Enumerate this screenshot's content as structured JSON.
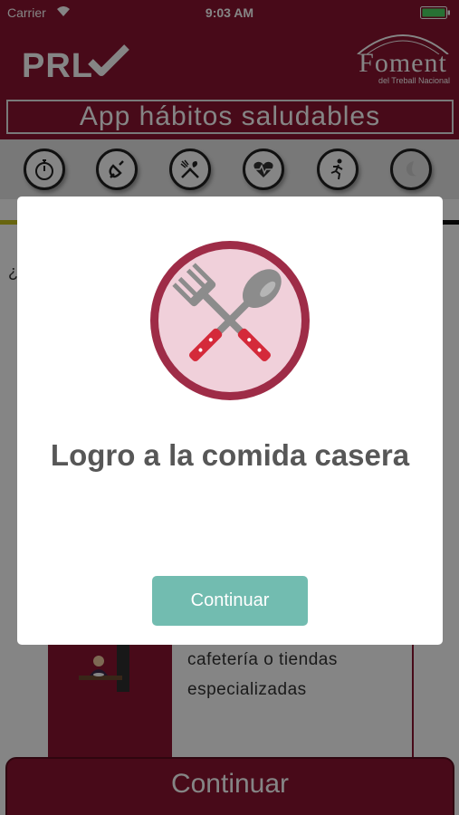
{
  "status_bar": {
    "carrier": "Carrier",
    "time": "9:03 AM"
  },
  "header": {
    "logo_text": "PRL",
    "org_name": "Foment",
    "org_sub": "del Treball Nacional",
    "app_title": "App hábitos saludables"
  },
  "categories": [
    {
      "icon": "stopwatch-icon"
    },
    {
      "icon": "phone-icon"
    },
    {
      "icon": "fork-spoon-icon"
    },
    {
      "icon": "heart-pulse-icon"
    },
    {
      "icon": "runner-icon"
    },
    {
      "icon": "moon-icon"
    }
  ],
  "page": {
    "question_fragment": "¿",
    "card_text": "cafetería o tiendas especializadas",
    "continue_label": "Continuar"
  },
  "modal": {
    "badge_icon": "fork-spoon-icon",
    "title": "Logro a la comida casera",
    "button_label": "Continuar"
  },
  "colors": {
    "brand": "#8b1530",
    "accent_button": "#72bcb0",
    "badge_fill": "#f0d0da",
    "badge_ring": "#9e2c47",
    "progress": "#c8c21e"
  }
}
